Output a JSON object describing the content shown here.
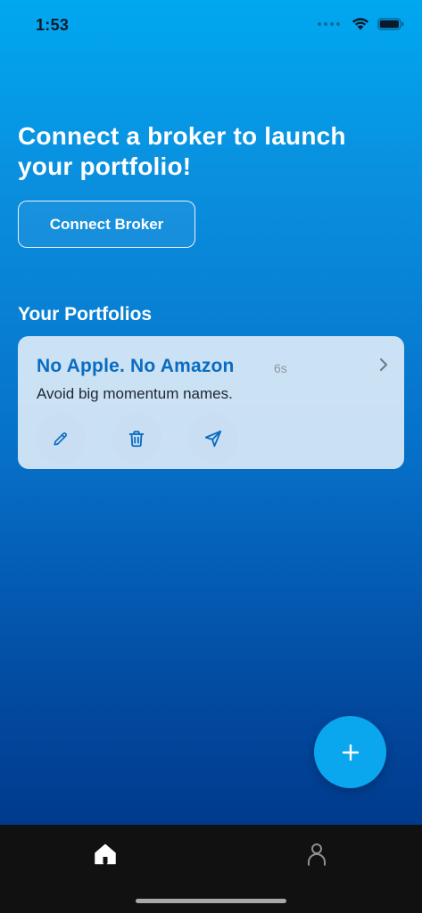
{
  "status_bar": {
    "time": "1:53",
    "signal_icon": "cellular-dots-icon",
    "wifi_icon": "wifi-icon",
    "battery_icon": "battery-icon"
  },
  "main": {
    "headline": "Connect a broker to launch your portfolio!",
    "connect_button_label": "Connect Broker",
    "section_title": "Your Portfolios",
    "portfolios": [
      {
        "title": "No Apple. No Amazon",
        "age": "6s",
        "description": "Avoid big momentum names.",
        "actions": [
          "pencil-icon",
          "trash-icon",
          "send-icon"
        ]
      }
    ]
  },
  "fab": {
    "icon": "plus-icon"
  },
  "tab_bar": {
    "tabs": [
      {
        "name": "home",
        "icon": "home-icon",
        "active": true
      },
      {
        "name": "profile",
        "icon": "person-icon",
        "active": false
      }
    ]
  },
  "colors": {
    "gradient_top": "#00a8f0",
    "gradient_bottom": "#003a8c",
    "card_title": "#0a6cc0",
    "fab": "#0aa6ee",
    "tab_bar": "#111111"
  }
}
